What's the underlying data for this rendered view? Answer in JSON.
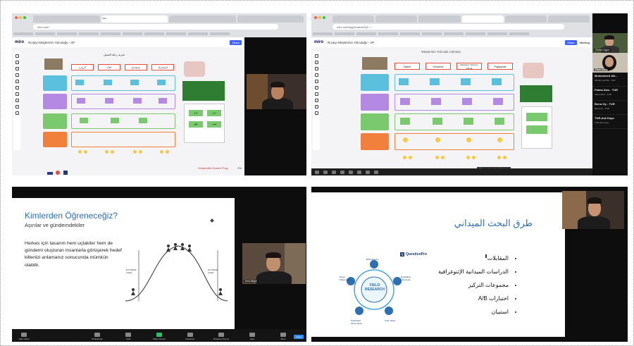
{
  "q1": {
    "window_title": "Miro",
    "url": "miro.com",
    "board_name": "Rızaiyı-Müşterinin Yolculuğu - AP",
    "share_label": "Share",
    "footer_brand": "Girişimcilik Destek Prog",
    "zoom_label": "2%",
    "map_title": "تجربة رحلة العميل",
    "phases": [
      "الزيارة",
      "Get",
      "استخدام",
      "المشاركة"
    ],
    "green_panel_labels": [
      "فرح",
      "حزن",
      "قلق",
      "غضب"
    ],
    "video_name": ""
  },
  "q2": {
    "url": "miro.com/app/board/uXjV.../",
    "board_name": "Rızaiyı-Müşterinin Yolculuğu - AP",
    "share_label": "Share",
    "meeting_label": "Meeting",
    "map_title": "Müşterinin Yolculuk Adımları",
    "phases": [
      "Ziyaret",
      "Gönderim",
      "Müşteriye Yardımcı Olmak",
      "Paylaşmak"
    ],
    "toast": "25 unassigned participants",
    "participants": [
      {
        "name": "Muhammed Alk...",
        "sub": "Muhammed Alk - TUR"
      },
      {
        "name": "Fatma Akıs - TUR",
        "sub": "Fatma Akıs - TUR"
      },
      {
        "name": "Berra Oy - TUR",
        "sub": "Berra Oy - TUR"
      },
      {
        "name": "TUR-Ask Kaya",
        "sub": "TUR-Ask Kaya"
      }
    ],
    "top_tile_label": "Gonca Ogun",
    "second_tile_label": "Dilan Aktaş"
  },
  "q3": {
    "title": "Kimlerden Öğreneceğiz?",
    "subtitle": "Aşırılar ve gündemdekiler",
    "body": "Herkes için tasarım hem uçtakiler hem de gündemi oluşturan insanlarla görüşerek hedef kitlenizi anlamanız sonucunda mümkün olabilir.",
    "curve_left_label": "EXTREME USER",
    "curve_right_label": "EXTREME USER",
    "video_name": "Emir Bilgin",
    "zoom_buttons": [
      "Start Video",
      "Participants",
      "Chat",
      "Share Screen",
      "Reactions",
      "Breakout Rooms",
      "Apps",
      "More"
    ],
    "end_label": "Leave"
  },
  "q4": {
    "title": "طرق البحث الميداني",
    "items": [
      "المقابلات",
      "الدراسات الميدانية الإثنوغرافية",
      "مجموعات التركيز",
      "اختبارات A/B",
      "استبيان"
    ],
    "logo_text": "QuestionPro",
    "diagram_center": "FIELD RESEARCH",
    "diagram_nodes": [
      "Ethnography",
      "Qualitative Interviews",
      "Case Study",
      "Participant Observation",
      "Direct Observation"
    ],
    "video_name": ""
  },
  "colors": {
    "accent_blue": "#2e6fb0",
    "miro_cyan": "#5bc0de",
    "miro_purple": "#b389e3",
    "miro_green": "#7bc96f",
    "miro_orange": "#f0803c",
    "miro_red": "#e74c3c"
  }
}
